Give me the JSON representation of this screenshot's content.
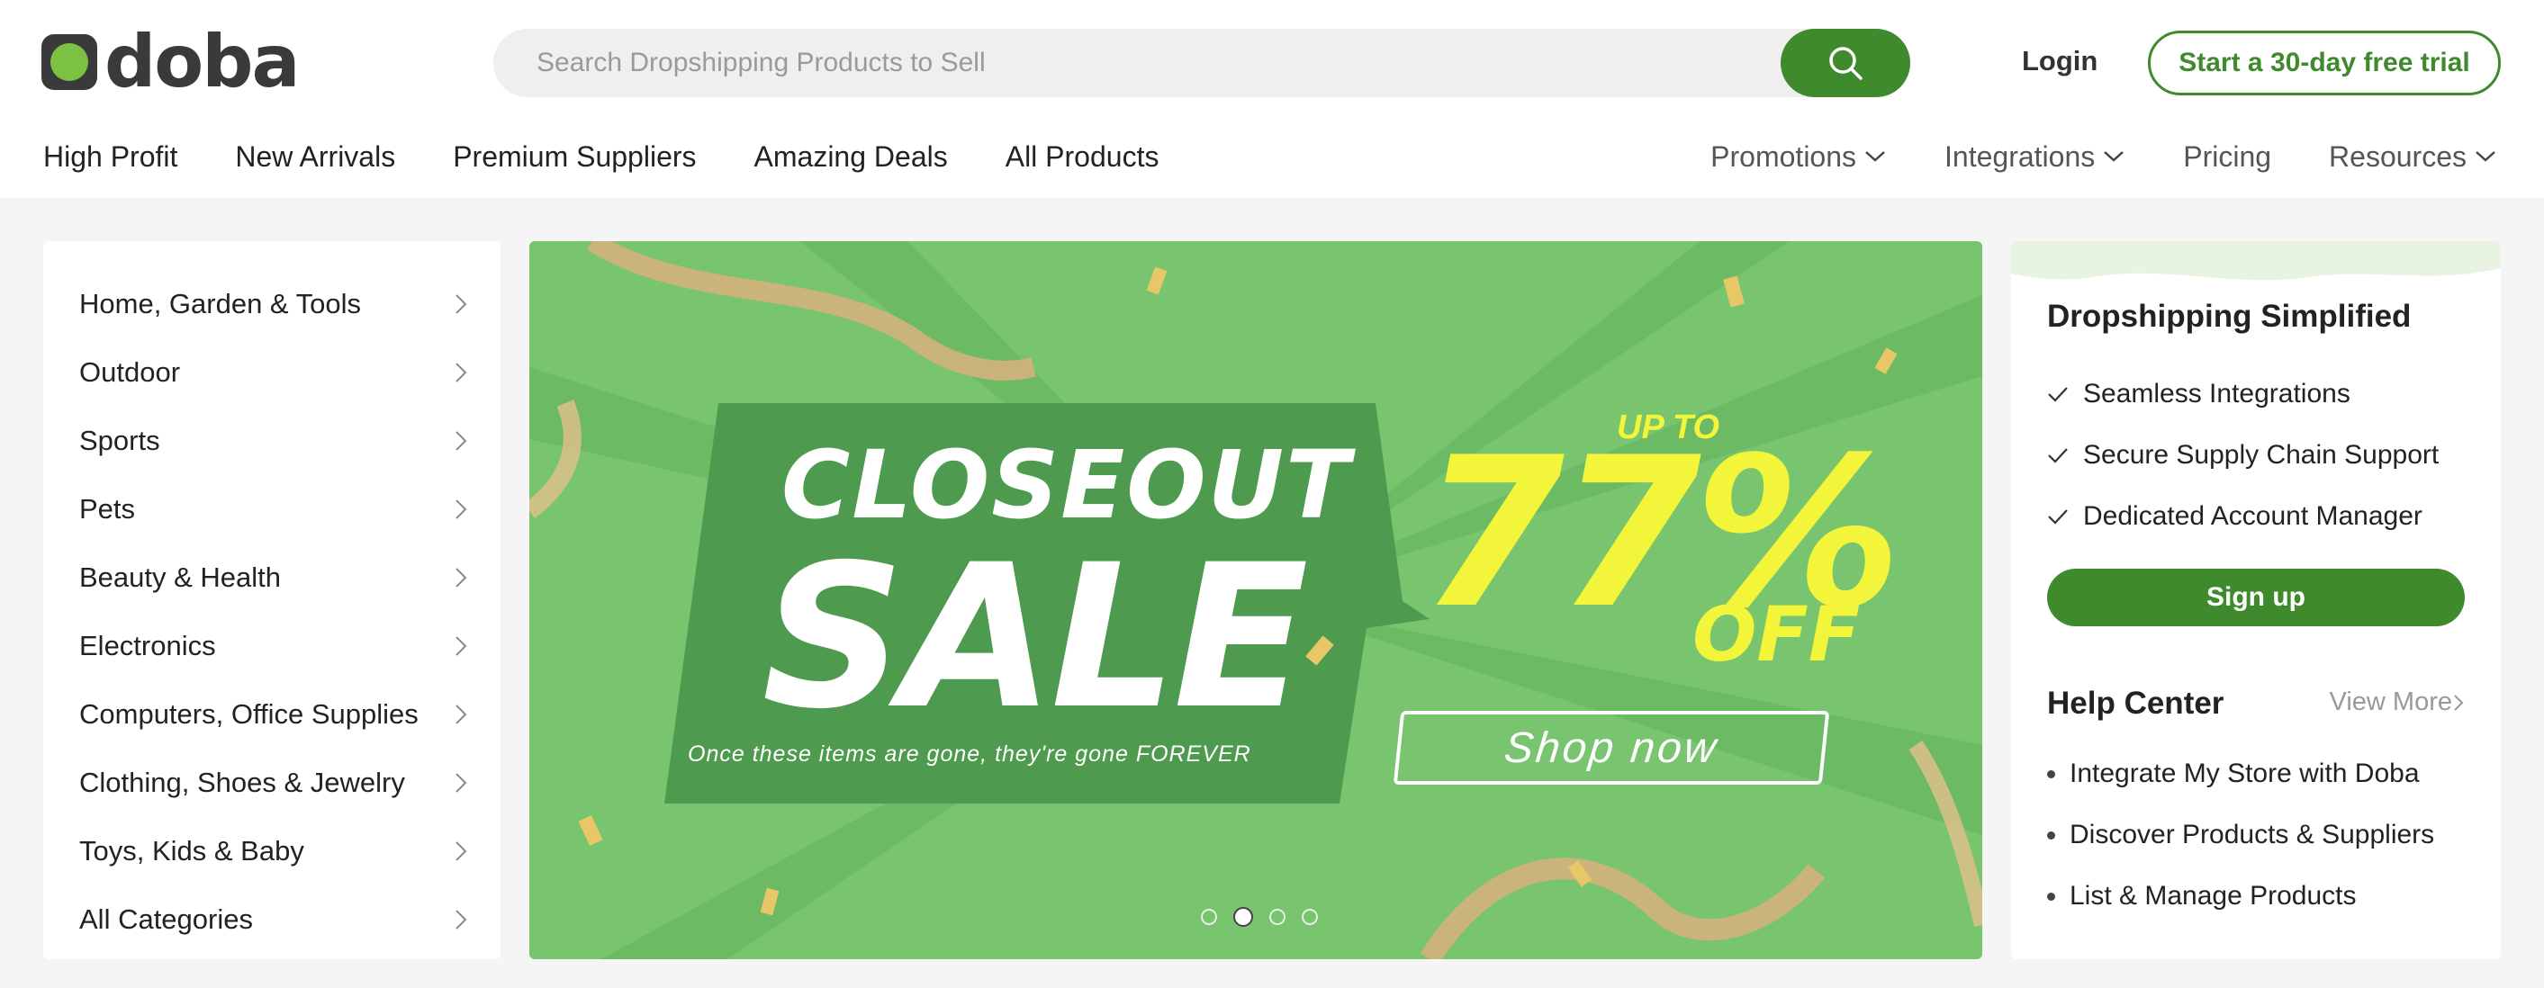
{
  "brand": {
    "name": "doba"
  },
  "search": {
    "placeholder": "Search Dropshipping Products to Sell",
    "icon": "search-icon"
  },
  "header": {
    "login": "Login",
    "trial": "Start a 30-day free trial"
  },
  "nav_left": [
    "High Profit",
    "New Arrivals",
    "Premium Suppliers",
    "Amazing Deals",
    "All Products"
  ],
  "nav_right": [
    {
      "label": "Promotions",
      "dropdown": true
    },
    {
      "label": "Integrations",
      "dropdown": true
    },
    {
      "label": "Pricing",
      "dropdown": false
    },
    {
      "label": "Resources",
      "dropdown": true
    }
  ],
  "categories": [
    "Home, Garden & Tools",
    "Outdoor",
    "Sports",
    "Pets",
    "Beauty & Health",
    "Electronics",
    "Computers, Office Supplies",
    "Clothing, Shoes & Jewelry",
    "Toys, Kids & Baby",
    "All Categories"
  ],
  "banner": {
    "headline": "CLOSEOUT",
    "headline2": "SALE",
    "tagline": "Once these items are gone, they're gone FOREVER",
    "upto": "UP TO",
    "percent": "77%",
    "off": "OFF",
    "cta": "Shop now",
    "slides": 4,
    "active_slide": 1
  },
  "side": {
    "title": "Dropshipping Simplified",
    "features": [
      "Seamless Integrations",
      "Secure Supply Chain Support",
      "Dedicated Account Manager"
    ],
    "signup": "Sign up",
    "help_title": "Help Center",
    "view_more": "View More",
    "help_items": [
      "Integrate My Store with Doba",
      "Discover Products & Suppliers",
      "List & Manage Products"
    ]
  },
  "colors": {
    "brand_green": "#3f8a2c",
    "banner_green": "#78c46f",
    "accent_yellow": "#f3f53a",
    "logo_dot": "#7cc242"
  }
}
